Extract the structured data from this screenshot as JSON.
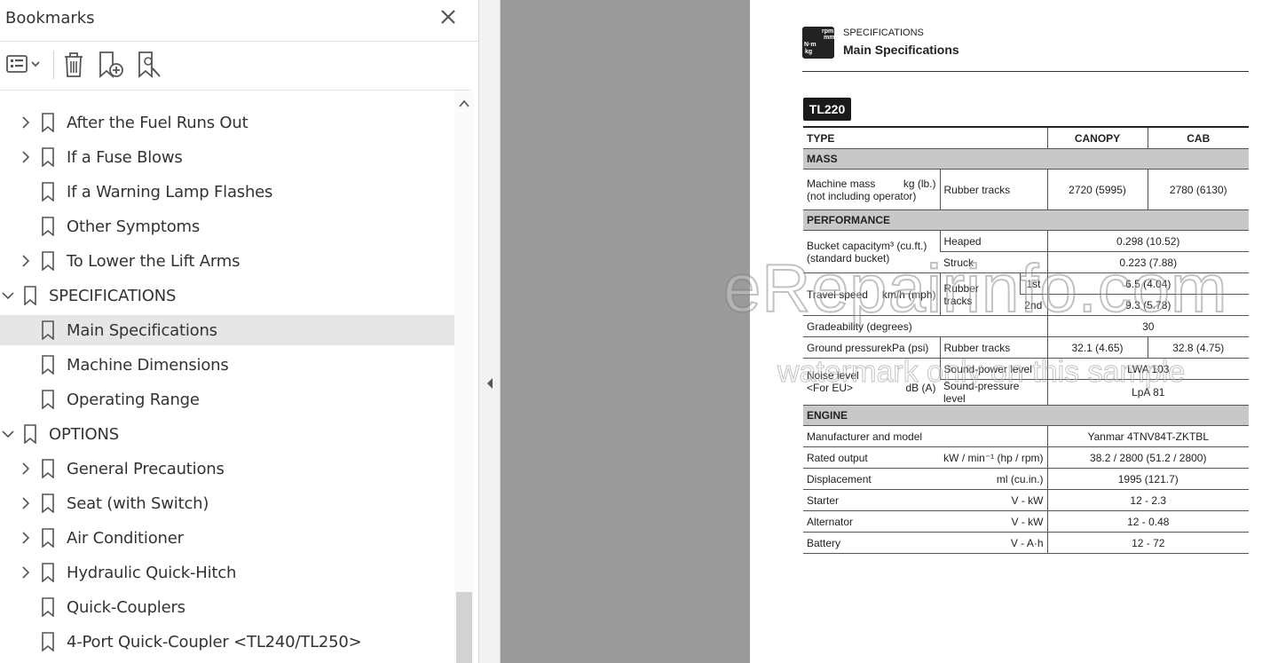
{
  "bookmarks_panel": {
    "title": "Bookmarks",
    "close_icon": "close-icon",
    "toolbar": {
      "options_icon": "list-options-icon",
      "delete_icon": "trash-icon",
      "new_bookmark_icon": "add-bookmark-icon",
      "find_bookmark_icon": "find-bookmark-icon"
    },
    "items": [
      {
        "label": "After the Fuel Runs Out",
        "expandable": true,
        "level": 1
      },
      {
        "label": "If a Fuse Blows",
        "expandable": true,
        "level": 1
      },
      {
        "label": "If a Warning Lamp Flashes",
        "expandable": false,
        "level": 1
      },
      {
        "label": "Other Symptoms",
        "expandable": false,
        "level": 1
      },
      {
        "label": "To Lower the Lift Arms",
        "expandable": true,
        "level": 1
      },
      {
        "label": "SPECIFICATIONS",
        "expandable": true,
        "expanded": true,
        "level": 0
      },
      {
        "label": "Main Specifications",
        "expandable": false,
        "level": 1,
        "selected": true
      },
      {
        "label": "Machine Dimensions",
        "expandable": false,
        "level": 1
      },
      {
        "label": "Operating Range",
        "expandable": false,
        "level": 1
      },
      {
        "label": "OPTIONS",
        "expandable": true,
        "expanded": true,
        "level": 0
      },
      {
        "label": "General Precautions",
        "expandable": true,
        "level": 1
      },
      {
        "label": "Seat (with Switch)",
        "expandable": true,
        "level": 1
      },
      {
        "label": "Air Conditioner",
        "expandable": true,
        "level": 1
      },
      {
        "label": "Hydraulic Quick-Hitch",
        "expandable": true,
        "level": 1
      },
      {
        "label": "Quick-Couplers",
        "expandable": false,
        "level": 1
      },
      {
        "label": "4-Port Quick-Coupler <TL240/TL250>",
        "expandable": false,
        "level": 1
      }
    ]
  },
  "document": {
    "icon_text": [
      "rpm",
      "mm",
      "N·m",
      "kg"
    ],
    "section_small": "SPECIFICATIONS",
    "section_title": "Main Specifications",
    "model": "TL220",
    "table": {
      "type_label": "TYPE",
      "col_canopy": "CANOPY",
      "col_cab": "CAB",
      "mass_section": "MASS",
      "machine_mass_label": "Machine mass",
      "machine_mass_unit": "kg (lb.)",
      "machine_mass_note": "(not including operator)",
      "rubber_tracks": "Rubber tracks",
      "mass_canopy": "2720 (5995)",
      "mass_cab": "2780 (6130)",
      "performance_section": "PERFORMANCE",
      "bucket_label": "Bucket capacity",
      "bucket_unit": "m³ (cu.ft.)",
      "bucket_note": "(standard bucket)",
      "heaped": "Heaped",
      "heaped_value": "0.298 (10.52)",
      "struck": "Struck",
      "struck_value": "0.223 (7.88)",
      "travel_speed_label": "Travel speed",
      "travel_speed_unit": "km/h (mph)",
      "rubber_tracks_split_1": "Rubber",
      "rubber_tracks_split_2": "tracks",
      "first": "1st",
      "first_value": "6.5 (4.04)",
      "second": "2nd",
      "second_value": "9.3 (5.78)",
      "gradeability_label": "Gradeability (degrees)",
      "gradeability_value": "30",
      "ground_pressure_label": "Ground pressure",
      "ground_pressure_unit": "kPa (psi)",
      "ground_pressure_canopy": "32.1 (4.65)",
      "ground_pressure_cab": "32.8 (4.75)",
      "noise_label": "Noise level",
      "noise_note": "<For EU>",
      "noise_unit": "dB (A)",
      "sound_power_label": "Sound-power level",
      "sound_power_value": "LWA 103",
      "sound_pressure_label": "Sound-pressure level",
      "sound_pressure_value": "LpA 81",
      "engine_section": "ENGINE",
      "manufacturer_label": "Manufacturer and model",
      "manufacturer_value": "Yanmar 4TNV84T-ZKTBL",
      "rated_output_label": "Rated output",
      "rated_output_unit": "kW / min⁻¹ (hp / rpm)",
      "rated_output_value": "38.2 / 2800 (51.2 / 2800)",
      "displacement_label": "Displacement",
      "displacement_unit": "ml (cu.in.)",
      "displacement_value": "1995 (121.7)",
      "starter_label": "Starter",
      "starter_unit": "V - kW",
      "starter_value": "12 - 2.3",
      "alternator_label": "Alternator",
      "alternator_unit": "V - kW",
      "alternator_value": "12 - 0.48",
      "battery_label": "Battery",
      "battery_unit": "V - A·h",
      "battery_value": "12 - 72"
    }
  },
  "watermark": {
    "line1": "eRepairinfo.com",
    "line2": "watermark only on this sample"
  }
}
